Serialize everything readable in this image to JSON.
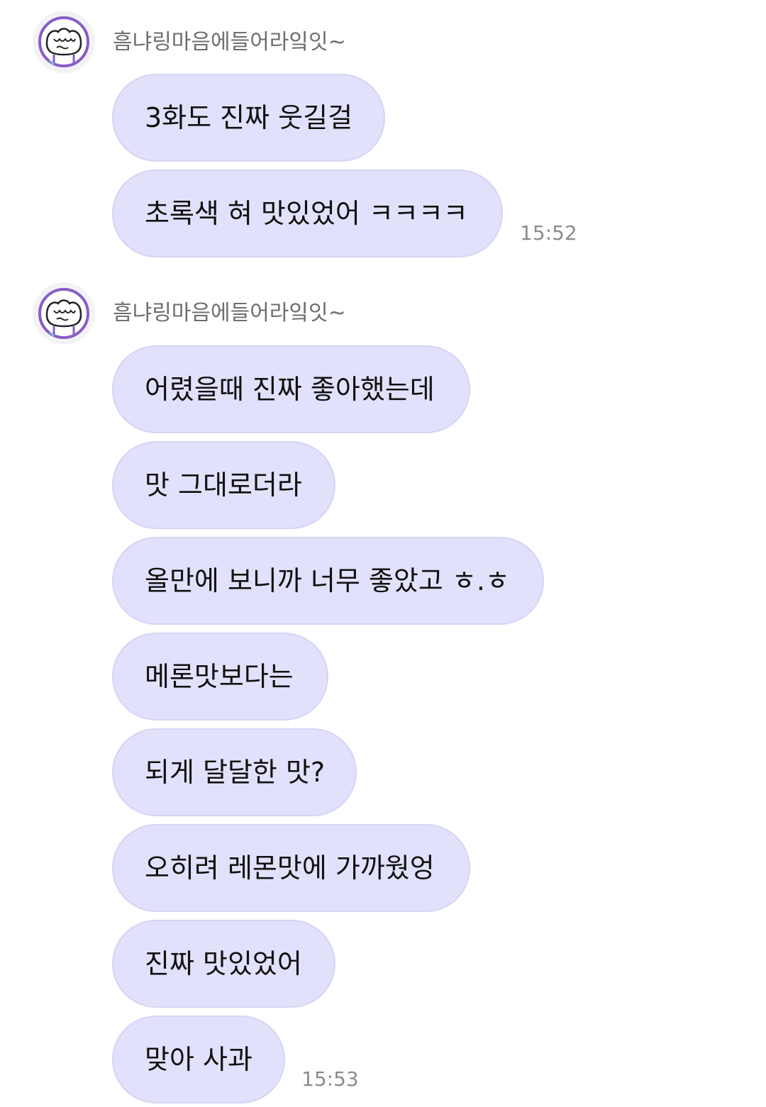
{
  "groups": [
    {
      "sender": "흠냐링마음에들어라잌잇~",
      "avatar_icon": "doodle-face-icon",
      "messages": [
        "3화도 진짜 웃길걸",
        "초록색 혀 맛있었어 ㅋㅋㅋㅋ"
      ],
      "time": "15:52"
    },
    {
      "sender": "흠냐링마음에들어라잌잇~",
      "avatar_icon": "doodle-face-icon",
      "messages": [
        "어렸을때 진짜 좋아했는데",
        "맛 그대로더라",
        "올만에 보니까 너무 좋았고 ㅎ.ㅎ",
        "메론맛보다는",
        "되게 달달한 맛?",
        "오히려 레몬맛에 가까웠엉",
        "진짜 맛있었어",
        "맞아 사과"
      ],
      "time": "15:53"
    }
  ],
  "colors": {
    "bubble_bg": "#e2e1fb",
    "bubble_border": "#d6d4f4",
    "avatar_accent": "#8a5cc7",
    "time_text": "#8c8c8c",
    "sender_text": "#6e6e6e"
  }
}
